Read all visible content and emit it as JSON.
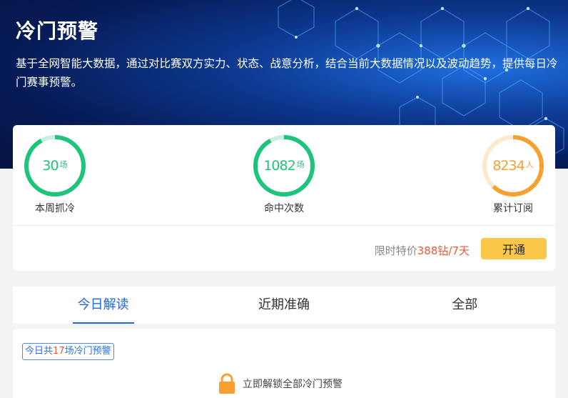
{
  "hero": {
    "title": "冷门预警",
    "description": "基于全网智能大数据，通过对比赛双方实力、状态、战意分析，结合当前大数据情况以及波动趋势，提供每日冷门赛事预警。"
  },
  "stats": [
    {
      "value": "30",
      "unit": "场",
      "label": "本周抓冷",
      "color": "#1ec47a",
      "track": "#c9f0dc",
      "progress": 0.92
    },
    {
      "value": "1082",
      "unit": "场",
      "label": "命中次数",
      "color": "#1ec47a",
      "track": "#c9f0dc",
      "progress": 0.92
    },
    {
      "value": "8234",
      "unit": "人",
      "label": "累计订阅",
      "color": "#f7a030",
      "track": "#fde9cc",
      "progress": 0.62
    }
  ],
  "promo": {
    "prefix": "限时特价",
    "price": "388钻/7天",
    "button": "开通"
  },
  "tabs": [
    {
      "label": "今日解读",
      "active": true
    },
    {
      "label": "近期准确",
      "active": false
    },
    {
      "label": "全部",
      "active": false
    }
  ],
  "content": {
    "badge_prefix": "今日共",
    "badge_count": "17",
    "badge_suffix": "场冷门预警",
    "unlock_text": "立即解锁全部冷门预警"
  },
  "colors": {
    "accent_blue": "#2266d9",
    "price_red": "#f0583a",
    "button_yellow": "#fcc84a",
    "ring_green": "#1ec47a",
    "ring_orange": "#f7a030",
    "lock_orange": "#f7a030"
  }
}
